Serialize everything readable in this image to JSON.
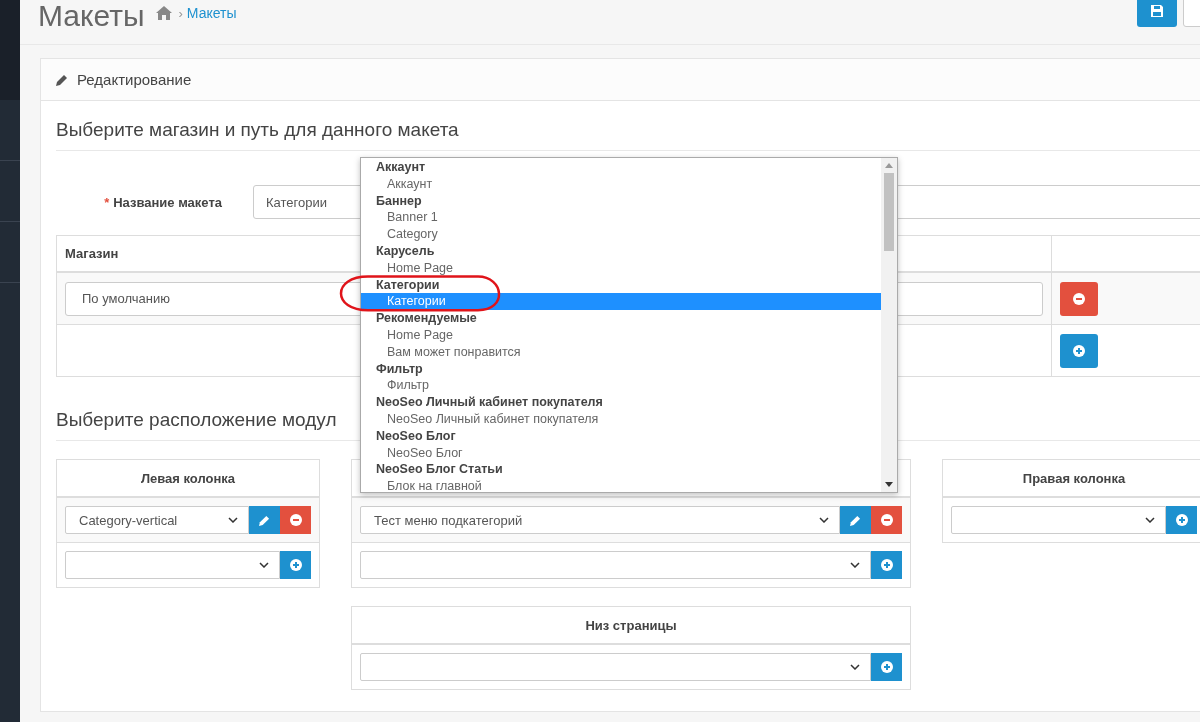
{
  "header": {
    "title": "Макеты",
    "breadcrumb_separator": "›",
    "breadcrumb": [
      {
        "label": "Макеты"
      }
    ]
  },
  "panel": {
    "title": "Редактирование"
  },
  "store_section": {
    "title": "Выберите магазин и путь для данного макета",
    "layout_name": {
      "required_mark": "*",
      "label": "Название макета",
      "value": "Категории"
    },
    "table": {
      "columns": [
        "Магазин"
      ],
      "rows": [
        {
          "store": "По умолчанию"
        }
      ]
    }
  },
  "modules_section": {
    "title": "Выберите расположение модул",
    "positions": [
      {
        "title": "Левая колонка",
        "modules": [
          {
            "kind": "module",
            "value": "Category-vertical"
          },
          {
            "kind": "add"
          }
        ]
      },
      {
        "modules": [
          {
            "kind": "module",
            "value": "Тест меню подкатегорий"
          },
          {
            "kind": "add"
          }
        ]
      },
      {
        "title": "Правая колонка",
        "modules": [
          {
            "kind": "add"
          }
        ]
      },
      {
        "title": "Низ страницы",
        "modules": [
          {
            "kind": "add"
          }
        ]
      }
    ]
  },
  "dropdown": {
    "groups": [
      {
        "label": "Аккаунт",
        "options": [
          {
            "label": "Аккаунт",
            "selected": false
          }
        ]
      },
      {
        "label": "Баннер",
        "options": [
          {
            "label": "Banner 1",
            "selected": false
          },
          {
            "label": "Category",
            "selected": false
          }
        ]
      },
      {
        "label": "Карусель",
        "options": [
          {
            "label": "Home Page",
            "selected": false
          }
        ]
      },
      {
        "label": "Категории",
        "options": [
          {
            "label": "Категории",
            "selected": true
          }
        ]
      },
      {
        "label": "Рекомендуемые",
        "options": [
          {
            "label": "Home Page",
            "selected": false
          },
          {
            "label": "Вам может понравится",
            "selected": false
          }
        ]
      },
      {
        "label": "Фильтр",
        "options": [
          {
            "label": "Фильтр",
            "selected": false
          }
        ]
      },
      {
        "label": "NeoSeo Личный кабинет покупателя",
        "options": [
          {
            "label": "NeoSeo Личный кабинет покупателя",
            "selected": false
          }
        ]
      },
      {
        "label": "NeoSeo Блог",
        "options": [
          {
            "label": "NeoSeo Блог",
            "selected": false
          }
        ]
      },
      {
        "label": "NeoSeo Блог Статьи",
        "options": [
          {
            "label": "Блок на главной",
            "selected": false
          }
        ]
      }
    ]
  }
}
